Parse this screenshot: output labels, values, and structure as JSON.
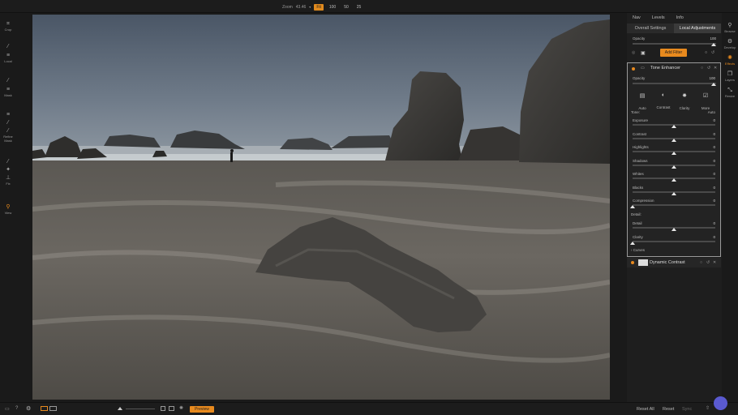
{
  "topbar": {
    "zoom_label": "Zoom",
    "zoom_value": "43.46",
    "zoom_presets": [
      "Fit",
      "100",
      "50",
      "25"
    ],
    "active_preset": "Fit"
  },
  "left_tools": [
    {
      "label": "Crop",
      "icon": "crop-icon"
    },
    {
      "label": "Local",
      "icon": "brush-icon"
    },
    {
      "label": "Mask",
      "icon": "mask-icon"
    },
    {
      "label": "Refine Mask",
      "icon": "refine-mask-icon"
    },
    {
      "label": "Fix",
      "icon": "fix-icon"
    },
    {
      "label": "View",
      "icon": "search-icon"
    }
  ],
  "right_tabs_top": [
    "Nav",
    "Levels",
    "Info"
  ],
  "right_tabs_second": [
    "Overall Settings",
    "Local Adjustments"
  ],
  "layer": {
    "opacity_label": "Opacity",
    "opacity_value": "100",
    "opacity_level": 1.0,
    "add_filter_label": "Add Filter"
  },
  "tone_enhancer": {
    "title": "Tone Enhancer",
    "opacity_label": "Opacity",
    "opacity_value": "100",
    "opacity_level": 1.0,
    "modes": [
      "Auto",
      "Contrast",
      "Clarity",
      "More"
    ],
    "tone_label": "Tone:",
    "auto_label": "Auto",
    "sliders": [
      {
        "label": "Exposure",
        "value": "0",
        "level": 0.5
      },
      {
        "label": "Contrast",
        "value": "0",
        "level": 0.5
      },
      {
        "label": "Highlights",
        "value": "0",
        "level": 0.5
      },
      {
        "label": "Shadows",
        "value": "0",
        "level": 0.5
      },
      {
        "label": "Whites",
        "value": "0",
        "level": 0.5
      },
      {
        "label": "Blacks",
        "value": "0",
        "level": 0.5
      },
      {
        "label": "Compression",
        "value": "0",
        "level": 0.0
      }
    ],
    "detail_label": "Detail:",
    "detail_sliders": [
      {
        "label": "Detail",
        "value": "0",
        "level": 0.5
      },
      {
        "label": "Clarity",
        "value": "0",
        "level": 0.0
      }
    ],
    "curves_label": "Curves"
  },
  "dynamic_contrast": {
    "title": "Dynamic Contrast"
  },
  "right_strip": [
    {
      "label": "Browse",
      "icon": "browse-icon"
    },
    {
      "label": "Develop",
      "icon": "develop-icon"
    },
    {
      "label": "Effects",
      "icon": "effects-icon"
    },
    {
      "label": "Layers",
      "icon": "layers-icon"
    },
    {
      "label": "Resize",
      "icon": "resize-icon"
    }
  ],
  "bottom": {
    "preview_label": "Preview",
    "reset_all_label": "Reset All",
    "reset_label": "Reset",
    "sync_label": "Sync"
  },
  "colors": {
    "accent": "#e88a1e",
    "panel_bg": "#1e1e1e"
  }
}
